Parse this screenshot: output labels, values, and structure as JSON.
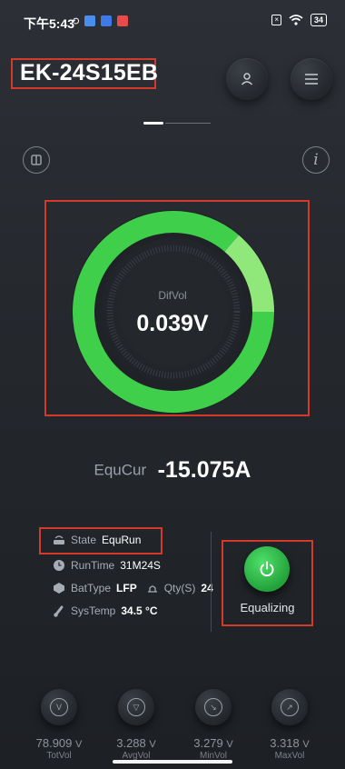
{
  "status_bar": {
    "time": "下午5:43",
    "battery": "34",
    "icons": [
      "sync-off-icon",
      "message-icon",
      "app-blue-icon",
      "app-red-icon",
      "sim-x-icon",
      "wifi-icon",
      "battery-icon"
    ]
  },
  "header": {
    "device_name": "EK-24S15EB",
    "buttons": [
      "user-icon",
      "menu-icon"
    ]
  },
  "pager": {
    "pages": 2,
    "active": 1
  },
  "toolbar": {
    "left_icon": "book-icon",
    "right_icon": "info-icon"
  },
  "gauge": {
    "label": "DifVol",
    "value": "0.039V",
    "colors": {
      "ring": "#3fcf4a",
      "ring_light": "#8fe879",
      "track": "#2a2e33",
      "center": "#25282c"
    }
  },
  "equ": {
    "label": "EquCur",
    "value": "-15.075A"
  },
  "info": {
    "state_label": "State",
    "state_value": "EquRun",
    "runtime_label": "RunTime",
    "runtime_value": "31M24S",
    "battype_label": "BatType",
    "battype_value": "LFP",
    "qty_label": "Qty(S)",
    "qty_value": "24",
    "systemp_label": "SysTemp",
    "systemp_value": "34.5 °C"
  },
  "equalize": {
    "label": "Equalizing",
    "color": "#2ec14a"
  },
  "stats": [
    {
      "value": "78.909",
      "unit": "V",
      "name": "TotVol",
      "icon": "voltage-icon"
    },
    {
      "value": "3.288",
      "unit": "V",
      "name": "AvgVol",
      "icon": "average-icon"
    },
    {
      "value": "3.279",
      "unit": "V",
      "name": "MinVol",
      "icon": "min-icon"
    },
    {
      "value": "3.318",
      "unit": "V",
      "name": "MaxVol",
      "icon": "max-icon"
    }
  ]
}
